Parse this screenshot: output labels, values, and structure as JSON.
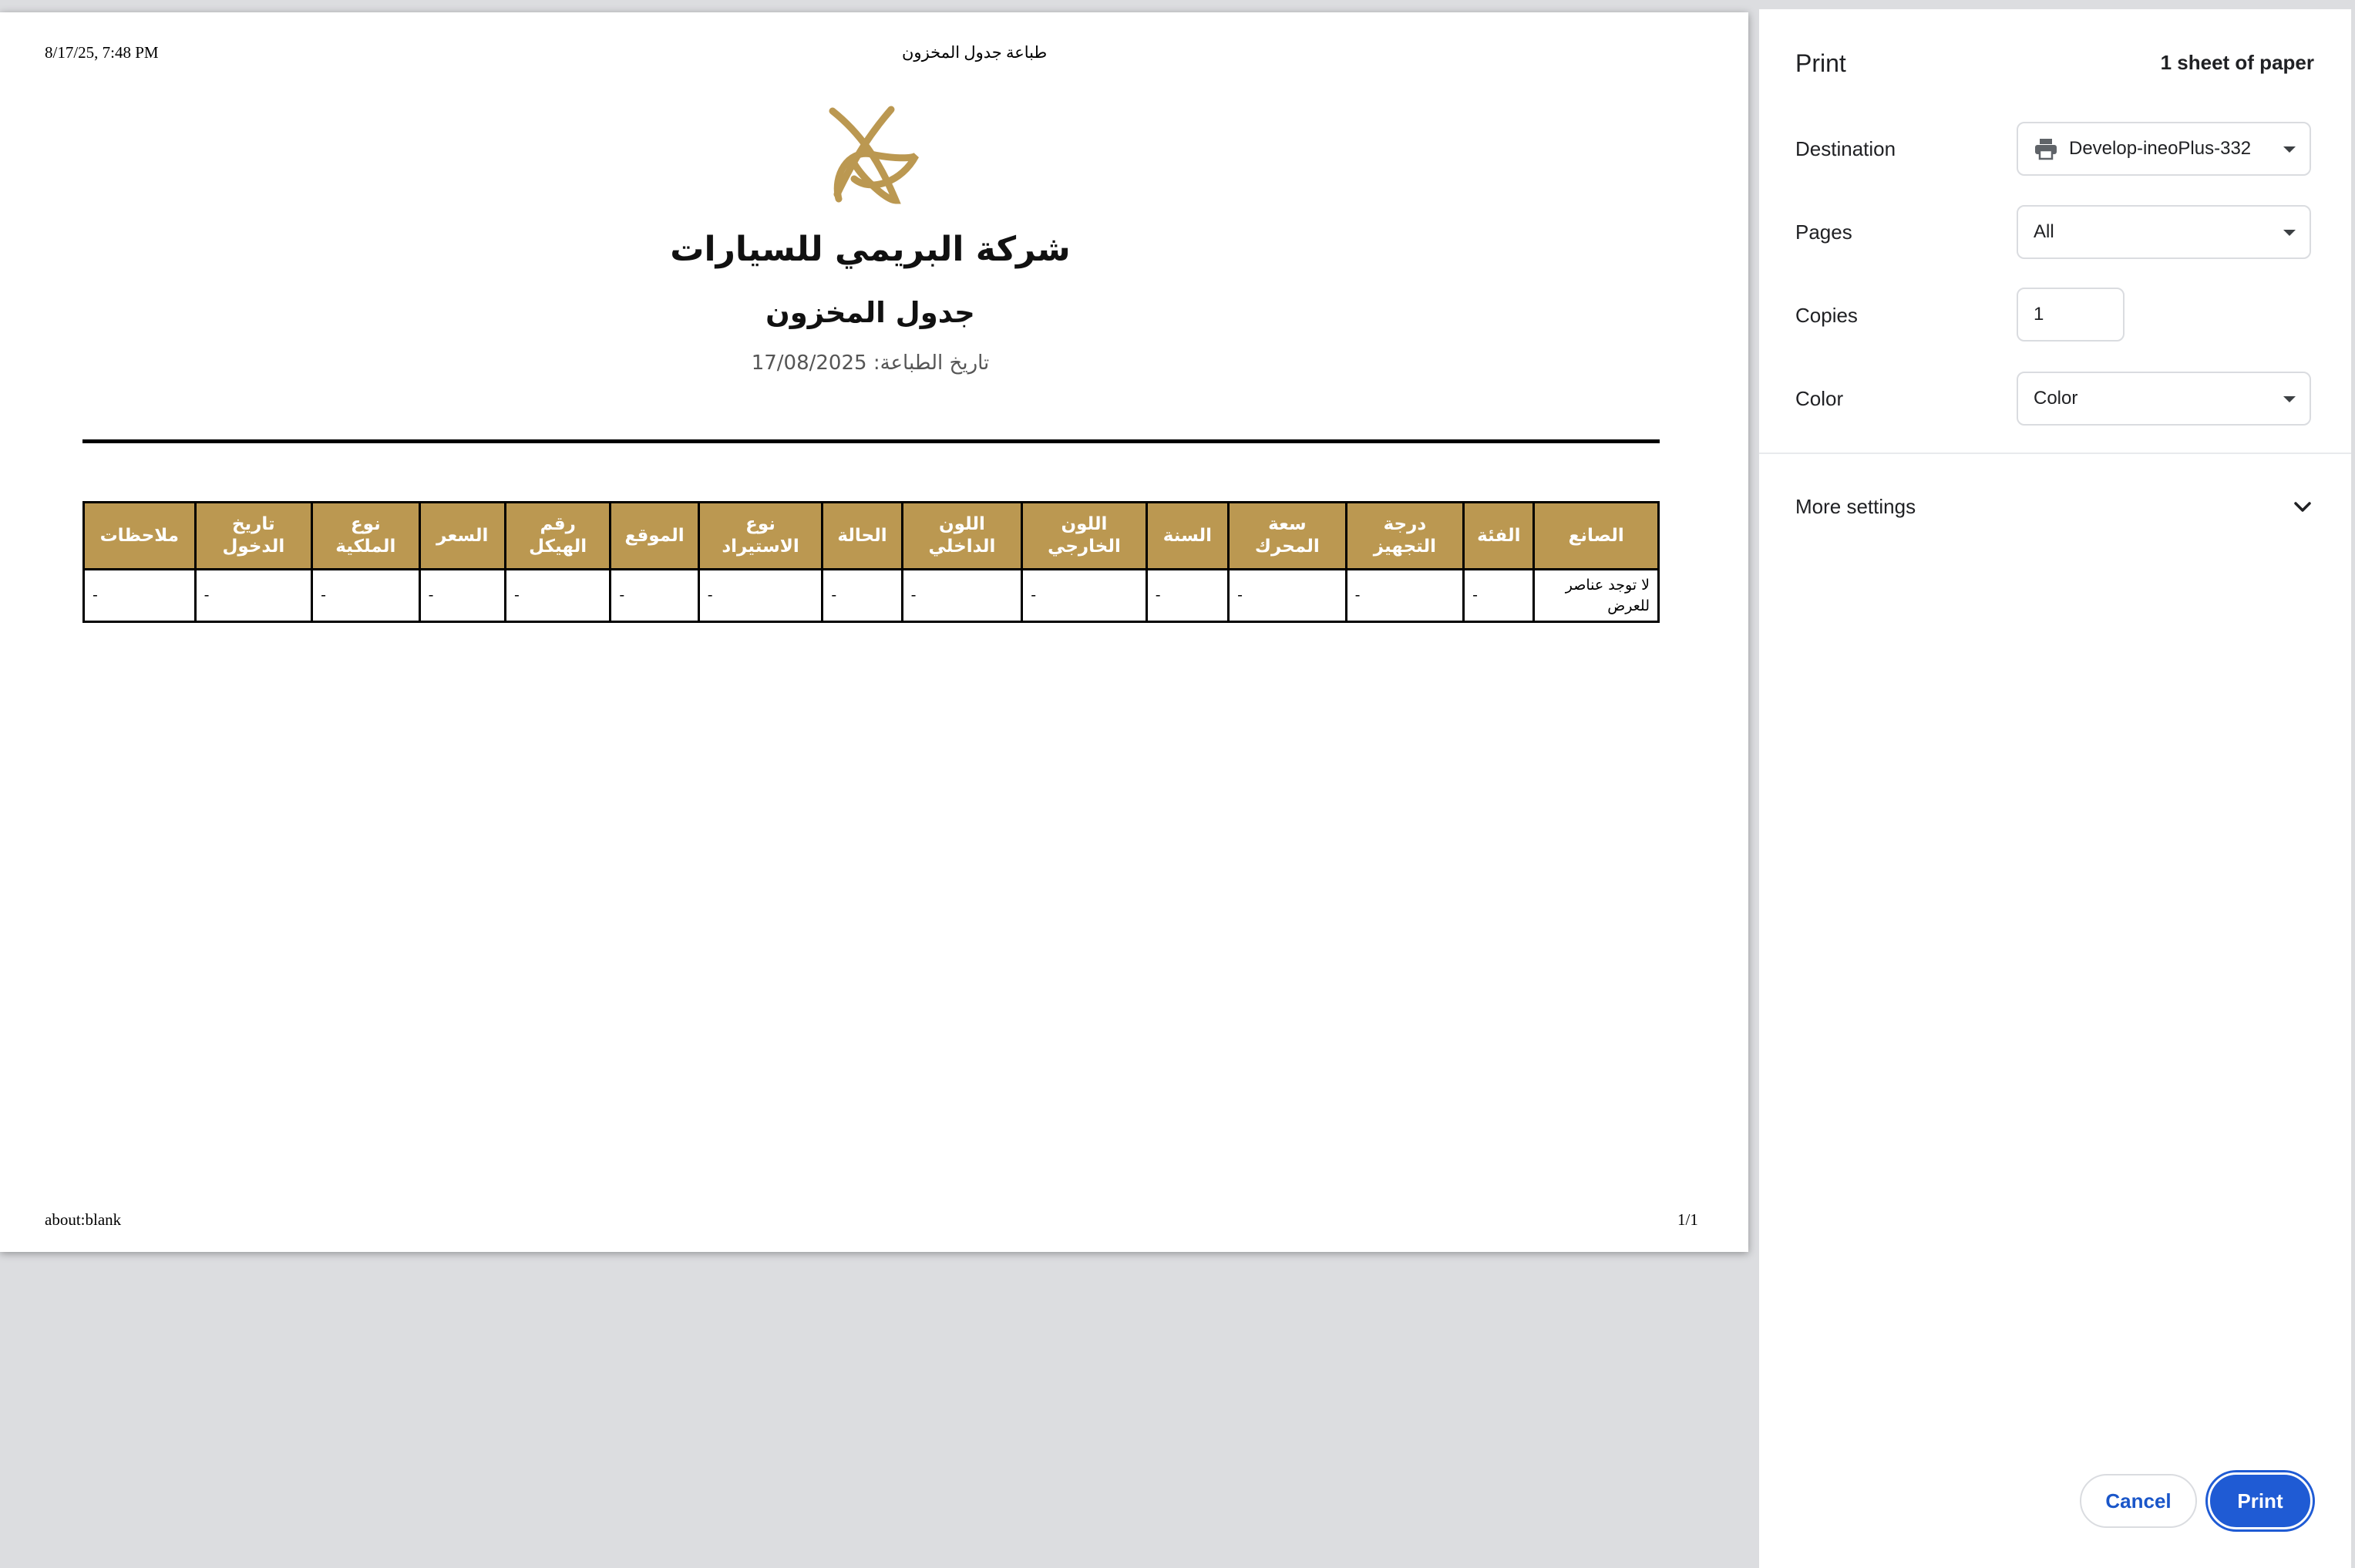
{
  "preview": {
    "header_left": "8/17/25, 7:48 PM",
    "header_center": "طباعة جدول المخزون",
    "company_name": "شركة البريمي للسيارات",
    "subtitle": "جدول المخزون",
    "print_date": "تاريخ الطباعة: 17/08/2025",
    "footer_left": "about:blank",
    "footer_right": "1/1",
    "brand_color": "#bb9851",
    "table": {
      "headers": [
        "الصانع",
        "الفئة",
        "درجة\nالتجهيز",
        "سعة\nالمحرك",
        "السنة",
        "اللون\nالخارجي",
        "اللون\nالداخلي",
        "الحالة",
        "نوع\nالاستيراد",
        "الموقع",
        "رقم\nالهيكل",
        "السعر",
        "نوع\nالملكية",
        "تاريخ\nالدخول",
        "ملاحظات"
      ],
      "row": [
        "لا توجد عناصر للعرض",
        "-",
        "-",
        "-",
        "-",
        "-",
        "-",
        "-",
        "-",
        "-",
        "-",
        "-",
        "-",
        "-",
        "-"
      ]
    }
  },
  "print_panel": {
    "title": "Print",
    "sheet_count": "1 sheet of paper",
    "destination_label": "Destination",
    "destination_value": "Develop-ineoPlus-332",
    "destination_icon": "printer-icon",
    "pages_label": "Pages",
    "pages_value": "All",
    "copies_label": "Copies",
    "copies_value": "1",
    "color_label": "Color",
    "color_value": "Color",
    "more_settings": "More settings",
    "cancel": "Cancel",
    "print": "Print",
    "accent_color": "#1f5bd4"
  }
}
